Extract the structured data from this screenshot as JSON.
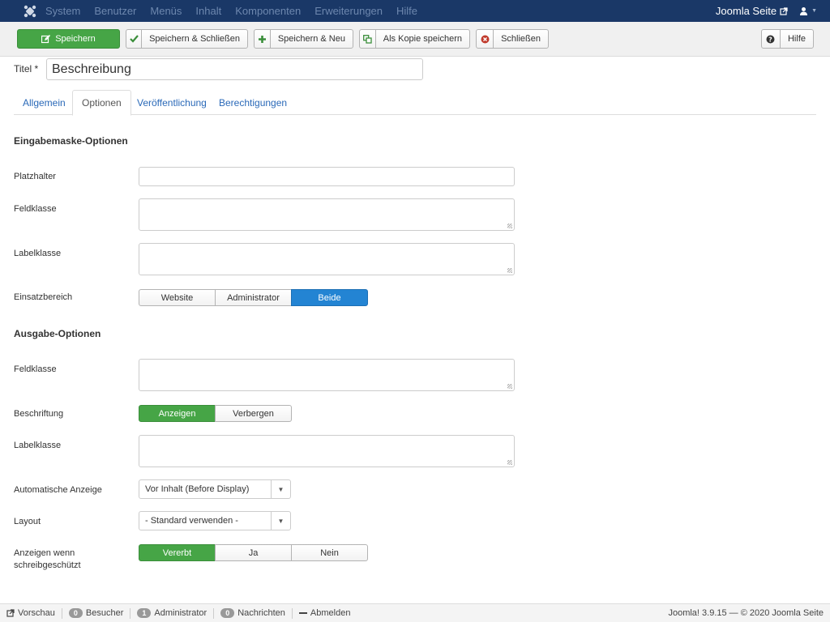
{
  "topbar": {
    "menu": [
      "System",
      "Benutzer",
      "Menüs",
      "Inhalt",
      "Komponenten",
      "Erweiterungen",
      "Hilfe"
    ],
    "site_link": "Joomla Seite"
  },
  "toolbar": {
    "save": "Speichern",
    "save_close": "Speichern & Schließen",
    "save_new": "Speichern & Neu",
    "save_copy": "Als Kopie speichern",
    "close": "Schließen",
    "help": "Hilfe"
  },
  "title": {
    "label": "Titel *",
    "value": "Beschreibung"
  },
  "tabs": [
    "Allgemein",
    "Optionen",
    "Veröffentlichung",
    "Berechtigungen"
  ],
  "active_tab": "Optionen",
  "input_section": {
    "heading": "Eingabemaske-Optionen",
    "placeholder_label": "Platzhalter",
    "fieldclass_label": "Feldklasse",
    "labelclass_label": "Labelklasse",
    "scope_label": "Einsatzbereich",
    "scope_options": [
      "Website",
      "Administrator",
      "Beide"
    ],
    "scope_selected": "Beide"
  },
  "output_section": {
    "heading": "Ausgabe-Optionen",
    "fieldclass_label": "Feldklasse",
    "caption_label": "Beschriftung",
    "caption_options": [
      "Anzeigen",
      "Verbergen"
    ],
    "caption_selected": "Anzeigen",
    "labelclass_label": "Labelklasse",
    "autodisplay_label": "Automatische Anzeige",
    "autodisplay_value": "Vor Inhalt (Before Display)",
    "layout_label": "Layout",
    "layout_value": "- Standard verwenden -",
    "readonly_label": "Anzeigen wenn schreibgeschützt",
    "readonly_options": [
      "Vererbt",
      "Ja",
      "Nein"
    ],
    "readonly_selected": "Vererbt"
  },
  "statusbar": {
    "preview": "Vorschau",
    "visitors_count": "0",
    "visitors": "Besucher",
    "admins_count": "1",
    "admins": "Administrator",
    "messages_count": "0",
    "messages": "Nachrichten",
    "logout": "Abmelden",
    "copyright": "Joomla! 3.9.15 — © 2020 Joomla Seite"
  },
  "colors": {
    "navbar": "#1a3867",
    "save_green": "#46a546",
    "active_blue": "#2384d3",
    "link": "#2a69b8"
  }
}
